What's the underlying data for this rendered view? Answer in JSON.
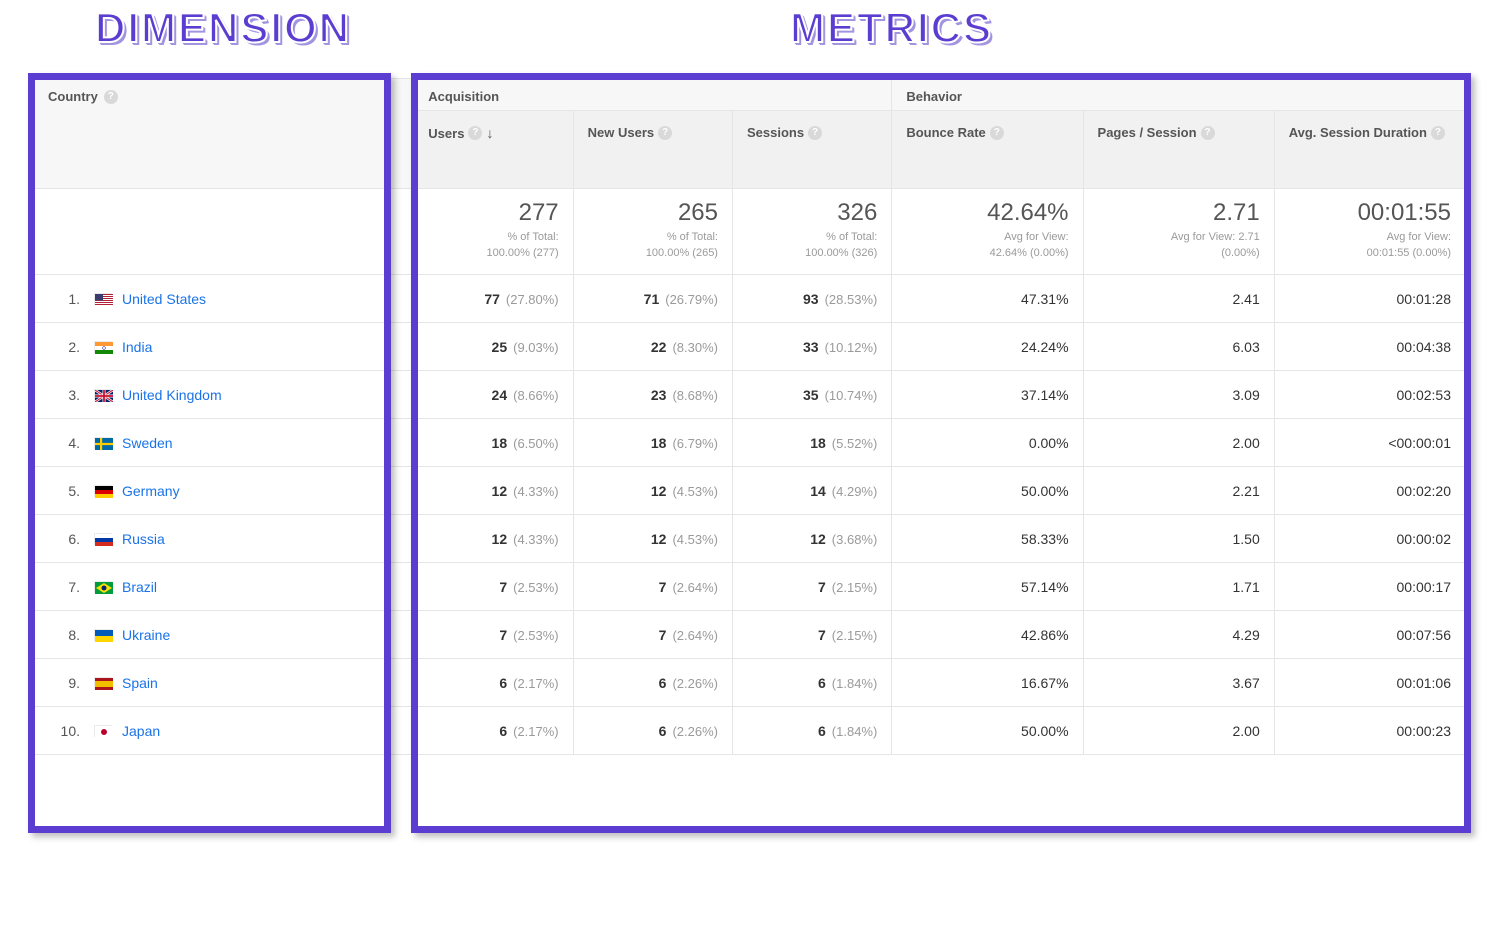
{
  "annot": {
    "dimension": "DIMENSION",
    "metrics": "METRICS"
  },
  "headers": {
    "dimension": "Country",
    "groups": {
      "acquisition": "Acquisition",
      "behavior": "Behavior"
    },
    "columns": {
      "users": "Users",
      "new_users": "New Users",
      "sessions": "Sessions",
      "bounce": "Bounce Rate",
      "pps": "Pages / Session",
      "avgdur": "Avg. Session Duration"
    }
  },
  "totals": {
    "users": {
      "big": "277",
      "sub1": "% of Total:",
      "sub2": "100.00% (277)"
    },
    "new_users": {
      "big": "265",
      "sub1": "% of Total:",
      "sub2": "100.00% (265)"
    },
    "sessions": {
      "big": "326",
      "sub1": "% of Total:",
      "sub2": "100.00% (326)"
    },
    "bounce": {
      "big": "42.64%",
      "sub1": "Avg for View:",
      "sub2": "42.64% (0.00%)"
    },
    "pps": {
      "big": "2.71",
      "sub1": "Avg for View: 2.71",
      "sub2": "(0.00%)"
    },
    "avgdur": {
      "big": "00:01:55",
      "sub1": "Avg for View:",
      "sub2": "00:01:55 (0.00%)"
    }
  },
  "rows": [
    {
      "rank": "1.",
      "flag": "us",
      "name": "United States",
      "users_v": "77",
      "users_p": "(27.80%)",
      "nu_v": "71",
      "nu_p": "(26.79%)",
      "s_v": "93",
      "s_p": "(28.53%)",
      "bounce": "47.31%",
      "pps": "2.41",
      "dur": "00:01:28"
    },
    {
      "rank": "2.",
      "flag": "in",
      "name": "India",
      "users_v": "25",
      "users_p": "(9.03%)",
      "nu_v": "22",
      "nu_p": "(8.30%)",
      "s_v": "33",
      "s_p": "(10.12%)",
      "bounce": "24.24%",
      "pps": "6.03",
      "dur": "00:04:38"
    },
    {
      "rank": "3.",
      "flag": "gb",
      "name": "United Kingdom",
      "users_v": "24",
      "users_p": "(8.66%)",
      "nu_v": "23",
      "nu_p": "(8.68%)",
      "s_v": "35",
      "s_p": "(10.74%)",
      "bounce": "37.14%",
      "pps": "3.09",
      "dur": "00:02:53"
    },
    {
      "rank": "4.",
      "flag": "se",
      "name": "Sweden",
      "users_v": "18",
      "users_p": "(6.50%)",
      "nu_v": "18",
      "nu_p": "(6.79%)",
      "s_v": "18",
      "s_p": "(5.52%)",
      "bounce": "0.00%",
      "pps": "2.00",
      "dur": "<00:00:01"
    },
    {
      "rank": "5.",
      "flag": "de",
      "name": "Germany",
      "users_v": "12",
      "users_p": "(4.33%)",
      "nu_v": "12",
      "nu_p": "(4.53%)",
      "s_v": "14",
      "s_p": "(4.29%)",
      "bounce": "50.00%",
      "pps": "2.21",
      "dur": "00:02:20"
    },
    {
      "rank": "6.",
      "flag": "ru",
      "name": "Russia",
      "users_v": "12",
      "users_p": "(4.33%)",
      "nu_v": "12",
      "nu_p": "(4.53%)",
      "s_v": "12",
      "s_p": "(3.68%)",
      "bounce": "58.33%",
      "pps": "1.50",
      "dur": "00:00:02"
    },
    {
      "rank": "7.",
      "flag": "br",
      "name": "Brazil",
      "users_v": "7",
      "users_p": "(2.53%)",
      "nu_v": "7",
      "nu_p": "(2.64%)",
      "s_v": "7",
      "s_p": "(2.15%)",
      "bounce": "57.14%",
      "pps": "1.71",
      "dur": "00:00:17"
    },
    {
      "rank": "8.",
      "flag": "ua",
      "name": "Ukraine",
      "users_v": "7",
      "users_p": "(2.53%)",
      "nu_v": "7",
      "nu_p": "(2.64%)",
      "s_v": "7",
      "s_p": "(2.15%)",
      "bounce": "42.86%",
      "pps": "4.29",
      "dur": "00:07:56"
    },
    {
      "rank": "9.",
      "flag": "es",
      "name": "Spain",
      "users_v": "6",
      "users_p": "(2.17%)",
      "nu_v": "6",
      "nu_p": "(2.26%)",
      "s_v": "6",
      "s_p": "(1.84%)",
      "bounce": "16.67%",
      "pps": "3.67",
      "dur": "00:01:06"
    },
    {
      "rank": "10.",
      "flag": "jp",
      "name": "Japan",
      "users_v": "6",
      "users_p": "(2.17%)",
      "nu_v": "6",
      "nu_p": "(2.26%)",
      "s_v": "6",
      "s_p": "(1.84%)",
      "bounce": "50.00%",
      "pps": "2.00",
      "dur": "00:00:23"
    }
  ],
  "chart_data": {
    "type": "table",
    "title": "Analytics by Country",
    "dimension": "Country",
    "columns": [
      "Users",
      "New Users",
      "Sessions",
      "Bounce Rate",
      "Pages / Session",
      "Avg. Session Duration"
    ],
    "totals": {
      "Users": 277,
      "New Users": 265,
      "Sessions": 326,
      "Bounce Rate": "42.64%",
      "Pages / Session": 2.71,
      "Avg. Session Duration": "00:01:55"
    },
    "rows": [
      {
        "Country": "United States",
        "Users": 77,
        "New Users": 71,
        "Sessions": 93,
        "Bounce Rate": "47.31%",
        "Pages / Session": 2.41,
        "Avg. Session Duration": "00:01:28"
      },
      {
        "Country": "India",
        "Users": 25,
        "New Users": 22,
        "Sessions": 33,
        "Bounce Rate": "24.24%",
        "Pages / Session": 6.03,
        "Avg. Session Duration": "00:04:38"
      },
      {
        "Country": "United Kingdom",
        "Users": 24,
        "New Users": 23,
        "Sessions": 35,
        "Bounce Rate": "37.14%",
        "Pages / Session": 3.09,
        "Avg. Session Duration": "00:02:53"
      },
      {
        "Country": "Sweden",
        "Users": 18,
        "New Users": 18,
        "Sessions": 18,
        "Bounce Rate": "0.00%",
        "Pages / Session": 2.0,
        "Avg. Session Duration": "<00:00:01"
      },
      {
        "Country": "Germany",
        "Users": 12,
        "New Users": 12,
        "Sessions": 14,
        "Bounce Rate": "50.00%",
        "Pages / Session": 2.21,
        "Avg. Session Duration": "00:02:20"
      },
      {
        "Country": "Russia",
        "Users": 12,
        "New Users": 12,
        "Sessions": 12,
        "Bounce Rate": "58.33%",
        "Pages / Session": 1.5,
        "Avg. Session Duration": "00:00:02"
      },
      {
        "Country": "Brazil",
        "Users": 7,
        "New Users": 7,
        "Sessions": 7,
        "Bounce Rate": "57.14%",
        "Pages / Session": 1.71,
        "Avg. Session Duration": "00:00:17"
      },
      {
        "Country": "Ukraine",
        "Users": 7,
        "New Users": 7,
        "Sessions": 7,
        "Bounce Rate": "42.86%",
        "Pages / Session": 4.29,
        "Avg. Session Duration": "00:07:56"
      },
      {
        "Country": "Spain",
        "Users": 6,
        "New Users": 6,
        "Sessions": 6,
        "Bounce Rate": "16.67%",
        "Pages / Session": 3.67,
        "Avg. Session Duration": "00:01:06"
      },
      {
        "Country": "Japan",
        "Users": 6,
        "New Users": 6,
        "Sessions": 6,
        "Bounce Rate": "50.00%",
        "Pages / Session": 2.0,
        "Avg. Session Duration": "00:00:23"
      }
    ]
  }
}
